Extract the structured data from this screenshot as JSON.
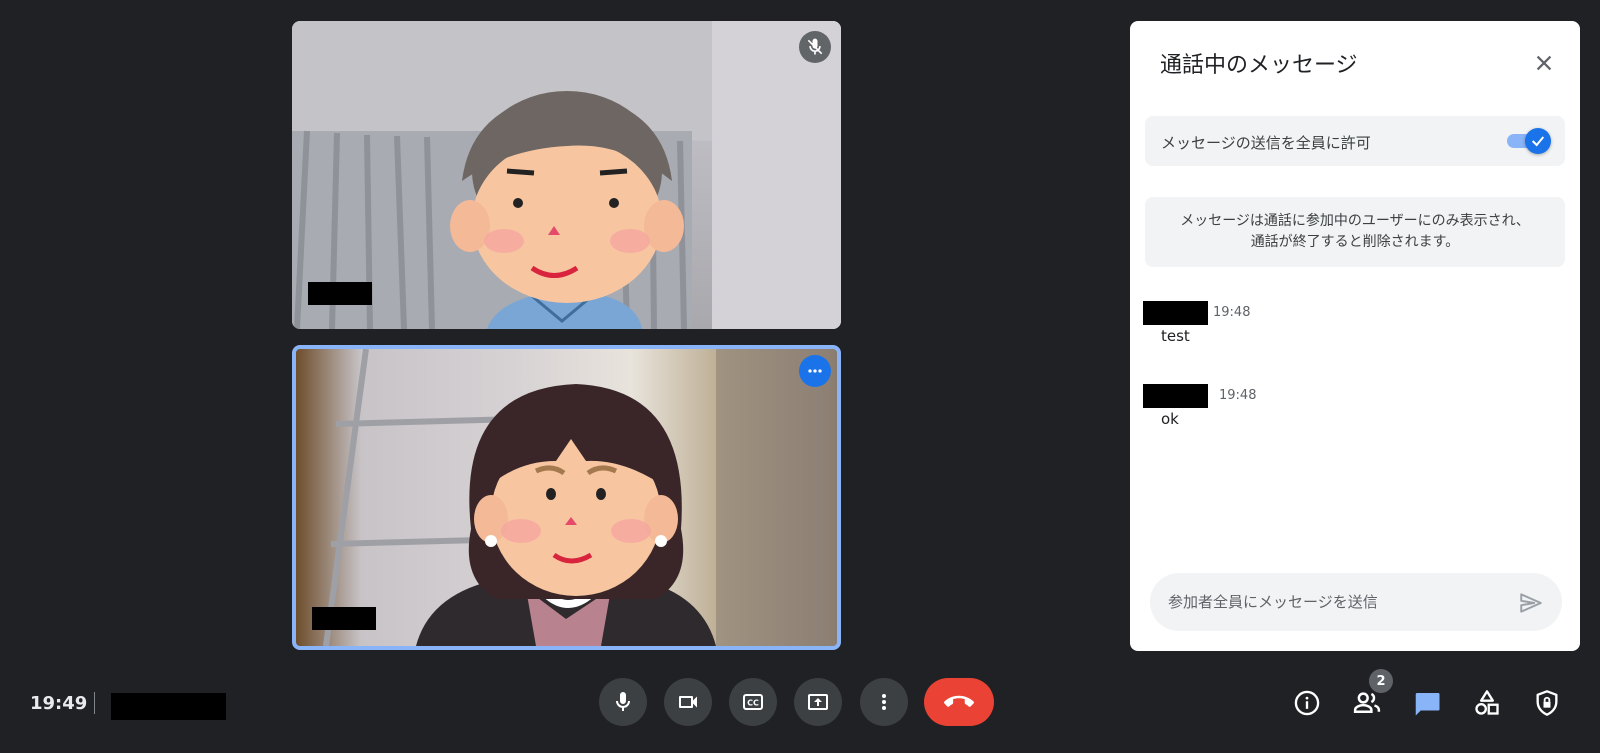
{
  "meeting": {
    "clock": "19:49",
    "participants_count": "2"
  },
  "chat_panel": {
    "title": "通話中のメッセージ",
    "allow_messages_label": "メッセージの送信を全員に許可",
    "allow_messages_enabled": true,
    "info_text_line1": "メッセージは通話に参加中のユーザーにのみ表示され、",
    "info_text_line2": "通話が終了すると削除されます。",
    "messages": [
      {
        "time": "19:48",
        "text": "test"
      },
      {
        "time": "19:48",
        "text": "ok"
      }
    ],
    "compose_placeholder": "参加者全員にメッセージを送信"
  },
  "icons": {
    "mic_off_badge": "mic-off-icon",
    "tile_menu": "more-horiz-icon",
    "close": "close-icon",
    "send": "send-icon",
    "mic": "mic-icon",
    "camera": "videocam-icon",
    "captions": "closed-caption-icon",
    "present": "present-to-all-icon",
    "more": "more-vert-icon",
    "leave": "call-end-icon",
    "info": "info-icon",
    "people": "people-icon",
    "chat": "chat-icon",
    "activities": "shapes-icon",
    "host_controls": "shield-lock-icon"
  },
  "colors": {
    "background": "#202124",
    "control_button": "#3c4043",
    "leave_button": "#ea4335",
    "accent_blue": "#1a73e8",
    "active_chat": "#8ab4f8",
    "panel": "#ffffff"
  }
}
